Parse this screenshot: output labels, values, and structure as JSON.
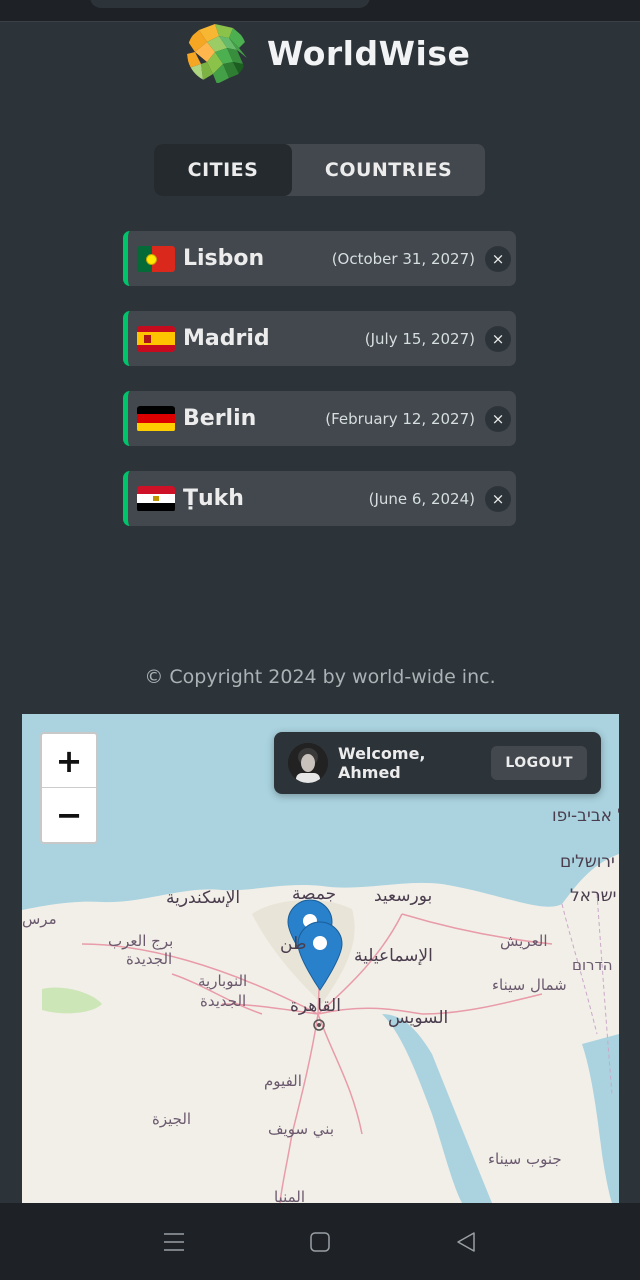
{
  "app": {
    "name": "WorldWise"
  },
  "tabs": [
    {
      "label": "CITIES",
      "active": true
    },
    {
      "label": "COUNTRIES",
      "active": false
    }
  ],
  "cities": [
    {
      "name": "Lisbon",
      "date": "(October 31, 2027)",
      "flag": "portugal"
    },
    {
      "name": "Madrid",
      "date": "(July 15, 2027)",
      "flag": "spain"
    },
    {
      "name": "Berlin",
      "date": "(February 12, 2027)",
      "flag": "germany"
    },
    {
      "name": "Ṭukh",
      "date": "(June 6, 2024)",
      "flag": "egypt"
    }
  ],
  "delete_symbol": "×",
  "footer": {
    "copyright": "© Copyright 2024 by world-wide inc."
  },
  "map": {
    "zoom_in": "+",
    "zoom_out": "−",
    "user": {
      "welcome": "Welcome, Ahmed",
      "logout": "LOGOUT"
    },
    "labels": {
      "alexandria": "الإسكندرية",
      "gomsa": "جمصة",
      "portsaid": "بورسعيد",
      "telaviv": "תל אביב-יפו",
      "jerusalem": "ירושלים",
      "israel": "ישראל",
      "borg": "برج العرب",
      "borg2": "الجديدة",
      "arish": "العريش",
      "ismailia": "الإسماعيلية",
      "hadarom": "הדרום",
      "northsinai": "شمال سيناء",
      "nubaria": "النوبارية",
      "nubaria2": "الجديدة",
      "cairo": "القاهرة",
      "suez": "السويس",
      "fayoum": "الفيوم",
      "giza": "الجيزة",
      "benisuef": "بني سويف",
      "southsinai": "جنوب سيناء",
      "minya": "المنيا",
      "marsa": "مرس",
      "tanta": "طن"
    }
  },
  "colors": {
    "background": "#2d3439",
    "card": "#42484d",
    "accent_green": "#00c46a",
    "sea": "#aad3df",
    "land": "#f2efe9"
  }
}
